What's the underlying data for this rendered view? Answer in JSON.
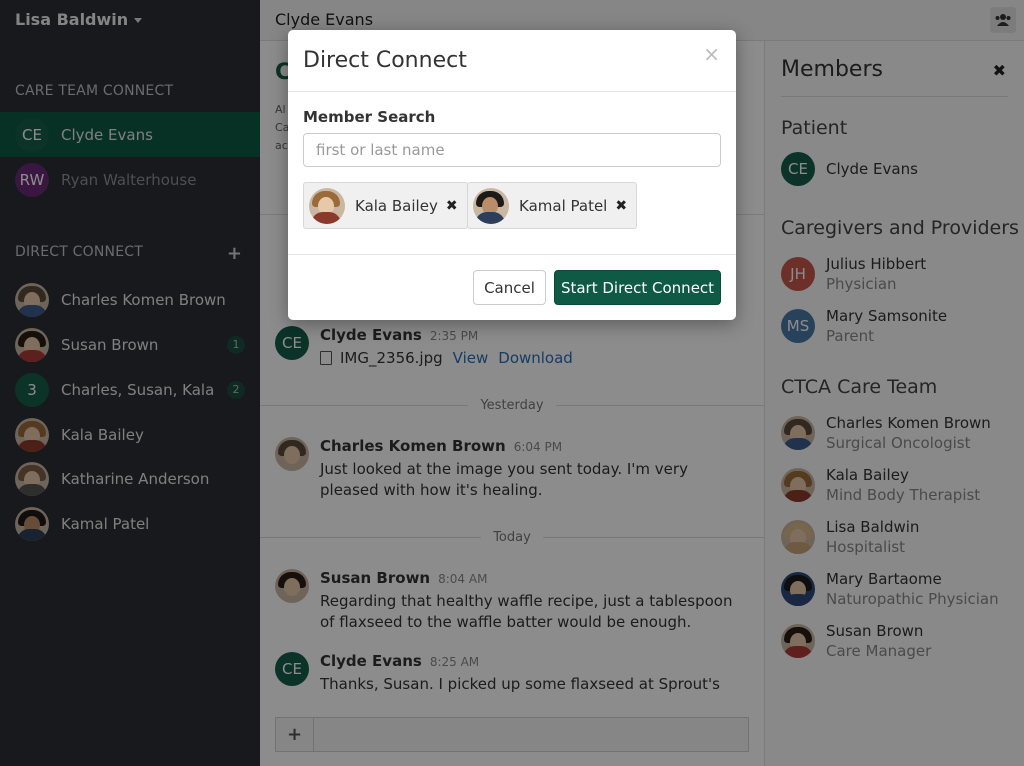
{
  "sidebar": {
    "user_name": "Lisa Baldwin",
    "care_team_title": "CARE TEAM CONNECT",
    "care_team": [
      {
        "initials": "CE",
        "name": "Clyde Evans",
        "active": true
      },
      {
        "initials": "RW",
        "name": "Ryan Walterhouse"
      }
    ],
    "direct_connect_title": "DIRECT CONNECT",
    "direct_connect_add": "+",
    "direct_connect": [
      {
        "name": "Charles Komen Brown",
        "badge": ""
      },
      {
        "name": "Susan Brown",
        "badge": "1"
      },
      {
        "initials": "3",
        "name": "Charles, Susan, Kala",
        "badge": "2"
      },
      {
        "name": "Kala Bailey",
        "badge": ""
      },
      {
        "name": "Katharine Anderson",
        "badge": ""
      },
      {
        "name": "Kamal Patel",
        "badge": ""
      }
    ]
  },
  "topbar": {
    "title": "Clyde Evans"
  },
  "chat": {
    "header_letter": "C",
    "sub_lines": [
      "Al",
      "Ca",
      "ac"
    ],
    "messages": [
      {
        "initials": "CE",
        "author": "Clyde Evans",
        "time": "2:35 PM",
        "file": "IMG_2356.jpg",
        "view": "View",
        "download": "Download"
      },
      {
        "author": "Charles Komen Brown",
        "time": "6:04 PM",
        "text": "Just looked at the image you sent today. I'm very pleased with how it's healing."
      },
      {
        "author": "Susan Brown",
        "time": "8:04 AM",
        "text": "Regarding that healthy waffle recipe, just a tablespoon of flaxseed to the waffle batter would be enough."
      },
      {
        "initials": "CE",
        "author": "Clyde Evans",
        "time": "8:25 AM",
        "text": "Thanks, Susan. I picked up some flaxseed at Sprout's"
      }
    ],
    "date_yesterday": "Yesterday",
    "date_today": "Today",
    "composer_plus": "+"
  },
  "members": {
    "title": "Members",
    "close": "✖",
    "patient_title": "Patient",
    "patient": {
      "initials": "CE",
      "name": "Clyde Evans"
    },
    "caregivers_title": "Caregivers and Providers",
    "caregivers": [
      {
        "initials": "JH",
        "name": "Julius Hibbert",
        "role": "Physician"
      },
      {
        "initials": "MS",
        "name": "Mary Samsonite",
        "role": "Parent"
      }
    ],
    "ctca_title": "CTCA Care Team",
    "ctca": [
      {
        "name": "Charles Komen Brown",
        "role": "Surgical Oncologist"
      },
      {
        "name": "Kala Bailey",
        "role": "Mind Body Therapist"
      },
      {
        "name": "Lisa Baldwin",
        "role": "Hospitalist"
      },
      {
        "name": "Mary Bartaome",
        "role": "Naturopathic Physician"
      },
      {
        "name": "Susan Brown",
        "role": "Care Manager"
      }
    ]
  },
  "modal": {
    "title": "Direct Connect",
    "close": "×",
    "label": "Member Search",
    "placeholder": "first or last name",
    "chips": [
      {
        "name": "Kala Bailey",
        "remove": "✖"
      },
      {
        "name": "Kamal Patel",
        "remove": "✖"
      }
    ],
    "cancel": "Cancel",
    "start": "Start Direct Connect"
  },
  "colors": {
    "brand_green": "#0f5a45",
    "sidebar_bg": "#2a2e33",
    "link_blue": "#2a6db5"
  }
}
